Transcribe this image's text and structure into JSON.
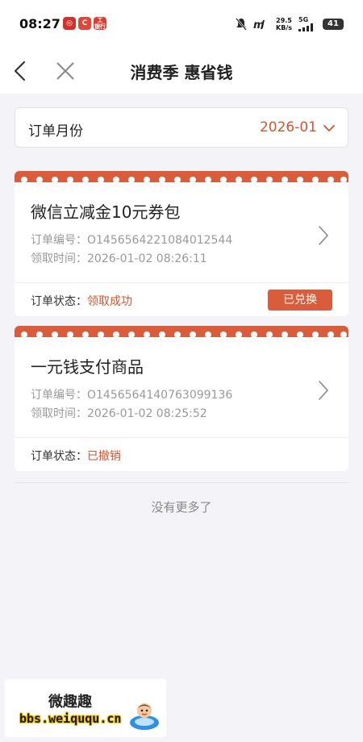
{
  "status_bar": {
    "time": "08:27",
    "net_speed_value": "29.5",
    "net_speed_unit": "KB/s",
    "network": "5G",
    "battery": "41",
    "app_badge_3": "工",
    "app_badge_3_sub": "银行"
  },
  "nav": {
    "title": "消费季 惠省钱"
  },
  "filter": {
    "label": "订单月份",
    "value": "2026-01"
  },
  "orders": [
    {
      "title": "微信立减金10元券包",
      "order_no_label": "订单编号：",
      "order_no": "O1456564221084012544",
      "time_label": "领取时间：",
      "time": "2026-01-02 08:26:11",
      "status_label": "订单状态：",
      "status": "领取成功",
      "action": "已兑换"
    },
    {
      "title": "一元钱支付商品",
      "order_no_label": "订单编号：",
      "order_no": "O1456564140763099136",
      "time_label": "领取时间：",
      "time": "2026-01-02 08:25:52",
      "status_label": "订单状态：",
      "status": "已撤销"
    }
  ],
  "footer": {
    "no_more": "没有更多了"
  },
  "watermark": {
    "name": "微趣趣",
    "url": "bbs.weiququ.cn"
  },
  "colors": {
    "accent": "#d95d3a",
    "accent_text": "#d0562f",
    "background": "#f4f4f8"
  }
}
